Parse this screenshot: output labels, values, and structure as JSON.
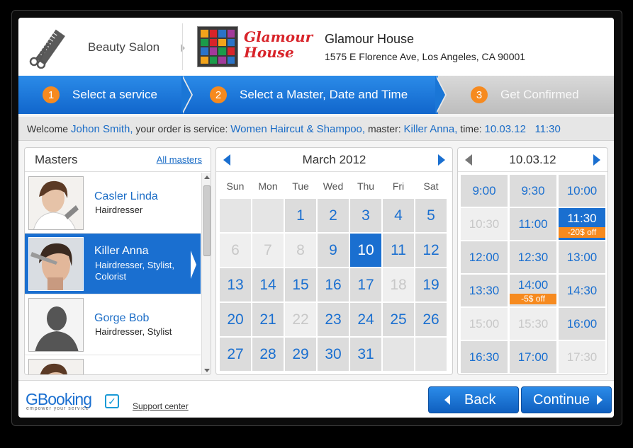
{
  "header": {
    "salon_type": "Beauty Salon",
    "logo_line1": "Glamour",
    "logo_line2": "House",
    "business_name": "Glamour House",
    "address": "1575 E Florence Ave, Los Angeles, CA 90001",
    "logo_colors": [
      "#f2a31b",
      "#d8242a",
      "#2a73c8",
      "#a23a9b",
      "#1b9b4a",
      "#d8242a",
      "#f2a31b",
      "#2a73c8",
      "#2a73c8",
      "#a23a9b",
      "#1b9b4a",
      "#d8242a",
      "#f2a31b",
      "#1b9b4a",
      "#a23a9b",
      "#2a73c8"
    ]
  },
  "steps": [
    {
      "num": "1",
      "label": "Select a service"
    },
    {
      "num": "2",
      "label": "Select a Master, Date and Time"
    },
    {
      "num": "3",
      "label": "Get Confirmed"
    }
  ],
  "welcome": {
    "prefix": "Welcome ",
    "user": "Johon Smith,",
    "order_text": " your order is service: ",
    "service": "Women Haircut & Shampoo,",
    "master_text": " master: ",
    "master": "Killer Anna,",
    "time_text": " time: ",
    "datetime": "10.03.12   11:30"
  },
  "masters": {
    "title": "Masters",
    "all_link": "All masters",
    "items": [
      {
        "name": "Casler Linda",
        "role": "Hairdresser"
      },
      {
        "name": "Killer Anna",
        "role": "Hairdresser, Stylist, Colorist"
      },
      {
        "name": "Gorge Bob",
        "role": "Hairdresser, Stylist"
      }
    ]
  },
  "calendar": {
    "title": "March 2012",
    "weekdays": [
      "Sun",
      "Mon",
      "Tue",
      "Wed",
      "Thu",
      "Fri",
      "Sat"
    ],
    "days": [
      {
        "d": "",
        "s": "empty"
      },
      {
        "d": "",
        "s": "empty"
      },
      {
        "d": "1",
        "s": ""
      },
      {
        "d": "2",
        "s": ""
      },
      {
        "d": "3",
        "s": ""
      },
      {
        "d": "4",
        "s": ""
      },
      {
        "d": "5",
        "s": ""
      },
      {
        "d": "6",
        "s": "dis"
      },
      {
        "d": "7",
        "s": "dis"
      },
      {
        "d": "8",
        "s": "dis"
      },
      {
        "d": "9",
        "s": ""
      },
      {
        "d": "10",
        "s": "sel"
      },
      {
        "d": "11",
        "s": ""
      },
      {
        "d": "12",
        "s": ""
      },
      {
        "d": "13",
        "s": ""
      },
      {
        "d": "14",
        "s": ""
      },
      {
        "d": "15",
        "s": ""
      },
      {
        "d": "16",
        "s": ""
      },
      {
        "d": "17",
        "s": ""
      },
      {
        "d": "18",
        "s": "dis"
      },
      {
        "d": "19",
        "s": ""
      },
      {
        "d": "20",
        "s": ""
      },
      {
        "d": "21",
        "s": ""
      },
      {
        "d": "22",
        "s": "dis"
      },
      {
        "d": "23",
        "s": ""
      },
      {
        "d": "24",
        "s": ""
      },
      {
        "d": "25",
        "s": ""
      },
      {
        "d": "26",
        "s": ""
      },
      {
        "d": "27",
        "s": ""
      },
      {
        "d": "28",
        "s": ""
      },
      {
        "d": "29",
        "s": ""
      },
      {
        "d": "30",
        "s": ""
      },
      {
        "d": "31",
        "s": ""
      },
      {
        "d": "",
        "s": "empty"
      },
      {
        "d": "",
        "s": "empty"
      }
    ]
  },
  "times": {
    "title": "10.03.12",
    "slots": [
      {
        "t": "9:00",
        "s": "",
        "disc": ""
      },
      {
        "t": "9:30",
        "s": "",
        "disc": ""
      },
      {
        "t": "10:00",
        "s": "",
        "disc": ""
      },
      {
        "t": "10:30",
        "s": "dis",
        "disc": ""
      },
      {
        "t": "11:00",
        "s": "",
        "disc": ""
      },
      {
        "t": "11:30",
        "s": "sel",
        "disc": "-20$ off"
      },
      {
        "t": "12:00",
        "s": "",
        "disc": ""
      },
      {
        "t": "12:30",
        "s": "",
        "disc": ""
      },
      {
        "t": "13:00",
        "s": "",
        "disc": ""
      },
      {
        "t": "13:30",
        "s": "",
        "disc": ""
      },
      {
        "t": "14:00",
        "s": "",
        "disc": "-5$ off"
      },
      {
        "t": "14:30",
        "s": "",
        "disc": ""
      },
      {
        "t": "15:00",
        "s": "dis",
        "disc": ""
      },
      {
        "t": "15:30",
        "s": "dis",
        "disc": ""
      },
      {
        "t": "16:00",
        "s": "",
        "disc": ""
      },
      {
        "t": "16:30",
        "s": "",
        "disc": ""
      },
      {
        "t": "17:00",
        "s": "",
        "disc": ""
      },
      {
        "t": "17:30",
        "s": "dis",
        "disc": ""
      }
    ]
  },
  "footer": {
    "brand_a": "GBooking",
    "brand_sub": "empower your service",
    "support": "Support center",
    "back": "Back",
    "continue": "Continue"
  }
}
